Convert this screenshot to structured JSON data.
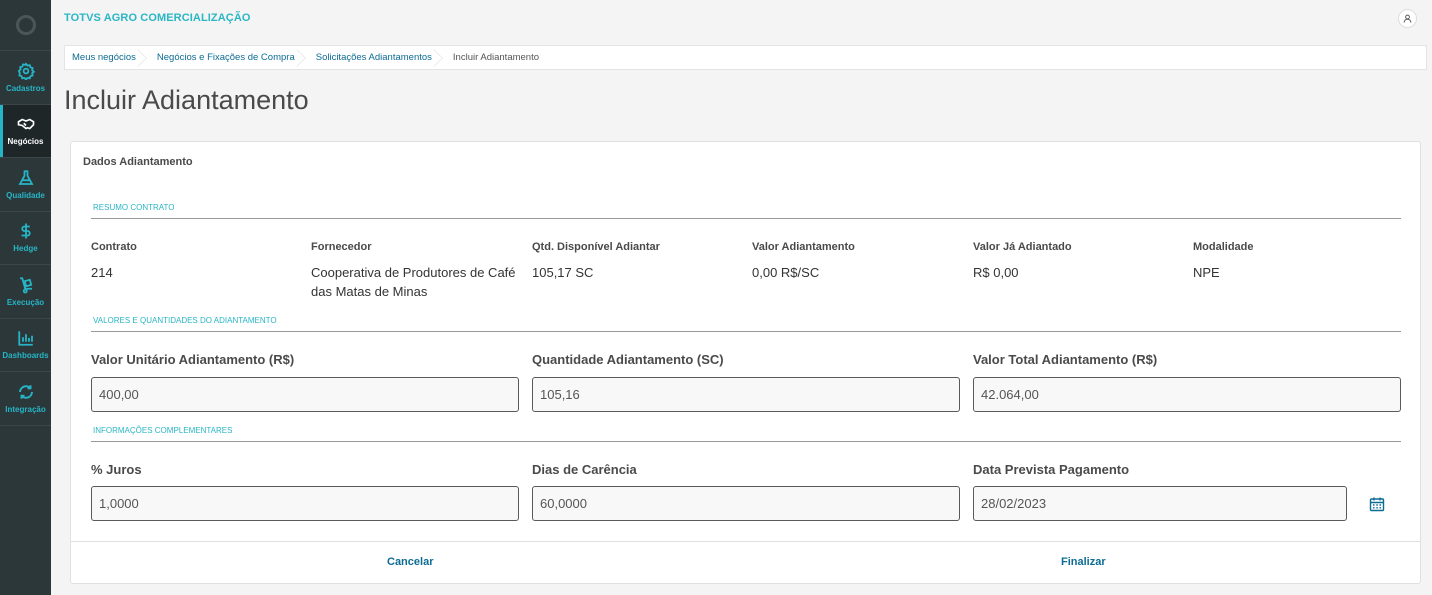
{
  "sidebar": {
    "items": [
      {
        "label": "Cadastros",
        "icon": "gear-icon"
      },
      {
        "label": "Negócios",
        "icon": "handshake-icon"
      },
      {
        "label": "Qualidade",
        "icon": "flask-icon"
      },
      {
        "label": "Hedge",
        "icon": "dollar-icon"
      },
      {
        "label": "Execução",
        "icon": "dolly-icon"
      },
      {
        "label": "Dashboards",
        "icon": "bar-chart-icon"
      },
      {
        "label": "Integração",
        "icon": "sync-icon"
      }
    ],
    "active_index": 1
  },
  "header": {
    "app_title": "TOTVS AGRO COMERCIALIZAÇÃO"
  },
  "breadcrumb": [
    "Meus negócios",
    "Negócios e Fixações de Compra",
    "Solicitações Adiantamentos",
    "Incluir Adiantamento"
  ],
  "page_title": "Incluir Adiantamento",
  "card": {
    "title": "Dados Adiantamento",
    "section_resumo": "RESUMO CONTRATO",
    "section_valores": "VALORES E QUANTIDADES DO ADIANTAMENTO",
    "section_info": "INFORMAÇÕES COMPLEMENTARES",
    "resumo": {
      "contrato": {
        "label": "Contrato",
        "value": "214"
      },
      "fornecedor": {
        "label": "Fornecedor",
        "value_line1": "Cooperativa de Produtores de Café",
        "value_line2": "das Matas de Minas"
      },
      "qtd": {
        "label": "Qtd. Disponível Adiantar",
        "value": "105,17 SC"
      },
      "valor_adiant": {
        "label": "Valor Adiantamento",
        "value": "0,00 R$/SC"
      },
      "valor_ja": {
        "label": "Valor Já Adiantado",
        "value": "R$ 0,00"
      },
      "modalidade": {
        "label": "Modalidade",
        "value": "NPE"
      }
    },
    "valores": {
      "unitario": {
        "label": "Valor Unitário Adiantamento (R$)",
        "value": "400,00"
      },
      "quantidade": {
        "label": "Quantidade Adiantamento (SC)",
        "value": "105,16"
      },
      "total": {
        "label": "Valor Total Adiantamento (R$)",
        "value": "42.064,00"
      }
    },
    "info": {
      "juros": {
        "label": "% Juros",
        "value": "1,0000"
      },
      "carencia": {
        "label": "Dias de Carência",
        "value": "60,0000"
      },
      "data": {
        "label": "Data Prevista Pagamento",
        "value": "28/02/2023"
      }
    },
    "footer": {
      "cancel": "Cancelar",
      "finish": "Finalizar"
    }
  },
  "colors": {
    "accent": "#29b6c5",
    "link": "#0c6c94",
    "sidebar_bg": "#2c3739"
  }
}
